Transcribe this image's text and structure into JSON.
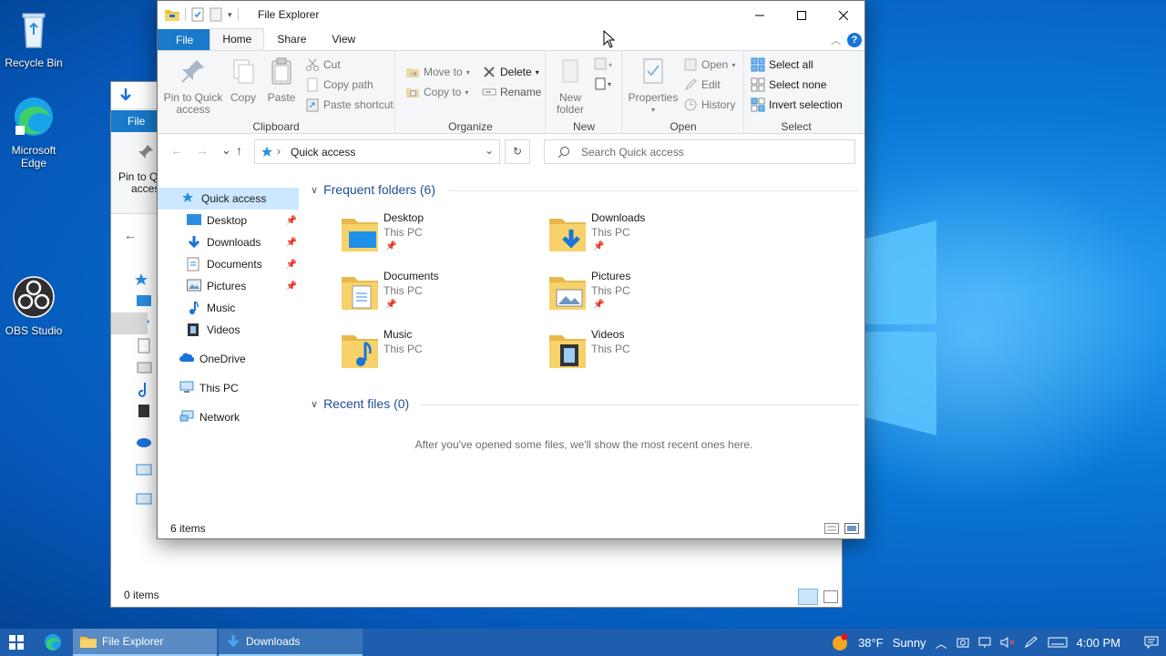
{
  "desktop": {
    "icons": [
      {
        "label": "Recycle Bin"
      },
      {
        "label": "Microsoft Edge"
      },
      {
        "label": "OBS Studio"
      }
    ]
  },
  "back_window": {
    "file_tab": "File",
    "pin_label_partial": "Pin to Qu",
    "pin_label_partial2": "acces",
    "status": "0 items"
  },
  "window": {
    "title": "File Explorer",
    "tabs": {
      "file": "File",
      "home": "Home",
      "share": "Share",
      "view": "View"
    },
    "help": "?"
  },
  "ribbon": {
    "clipboard": {
      "label": "Clipboard",
      "pin": "Pin to Quick access",
      "copy": "Copy",
      "paste": "Paste",
      "cut": "Cut",
      "copy_path": "Copy path",
      "paste_shortcut": "Paste shortcut"
    },
    "organize": {
      "label": "Organize",
      "move_to": "Move to",
      "copy_to": "Copy to",
      "delete": "Delete",
      "rename": "Rename"
    },
    "new": {
      "label": "New",
      "new_folder": "New folder"
    },
    "open": {
      "label": "Open",
      "properties": "Properties",
      "open": "Open",
      "edit": "Edit",
      "history": "History"
    },
    "select": {
      "label": "Select",
      "select_all": "Select all",
      "select_none": "Select none",
      "invert": "Invert selection"
    }
  },
  "address": {
    "path": "Quick access",
    "search_placeholder": "Search Quick access"
  },
  "nav": {
    "items": [
      {
        "label": "Quick access"
      },
      {
        "label": "Desktop"
      },
      {
        "label": "Downloads"
      },
      {
        "label": "Documents"
      },
      {
        "label": "Pictures"
      },
      {
        "label": "Music"
      },
      {
        "label": "Videos"
      },
      {
        "label": "OneDrive"
      },
      {
        "label": "This PC"
      },
      {
        "label": "Network"
      }
    ]
  },
  "content": {
    "frequent_header": "Frequent folders (6)",
    "recent_header": "Recent files (0)",
    "folders": [
      {
        "name": "Desktop",
        "location": "This PC"
      },
      {
        "name": "Downloads",
        "location": "This PC"
      },
      {
        "name": "Documents",
        "location": "This PC"
      },
      {
        "name": "Pictures",
        "location": "This PC"
      },
      {
        "name": "Music",
        "location": "This PC"
      },
      {
        "name": "Videos",
        "location": "This PC"
      }
    ],
    "empty_message": "After you've opened some files, we'll show the most recent ones here."
  },
  "status": {
    "items": "6 items"
  },
  "taskbar": {
    "apps": [
      {
        "label": "File Explorer"
      },
      {
        "label": "Downloads"
      }
    ],
    "weather_temp": "38°F",
    "weather_cond": "Sunny",
    "time": "4:00 PM"
  }
}
